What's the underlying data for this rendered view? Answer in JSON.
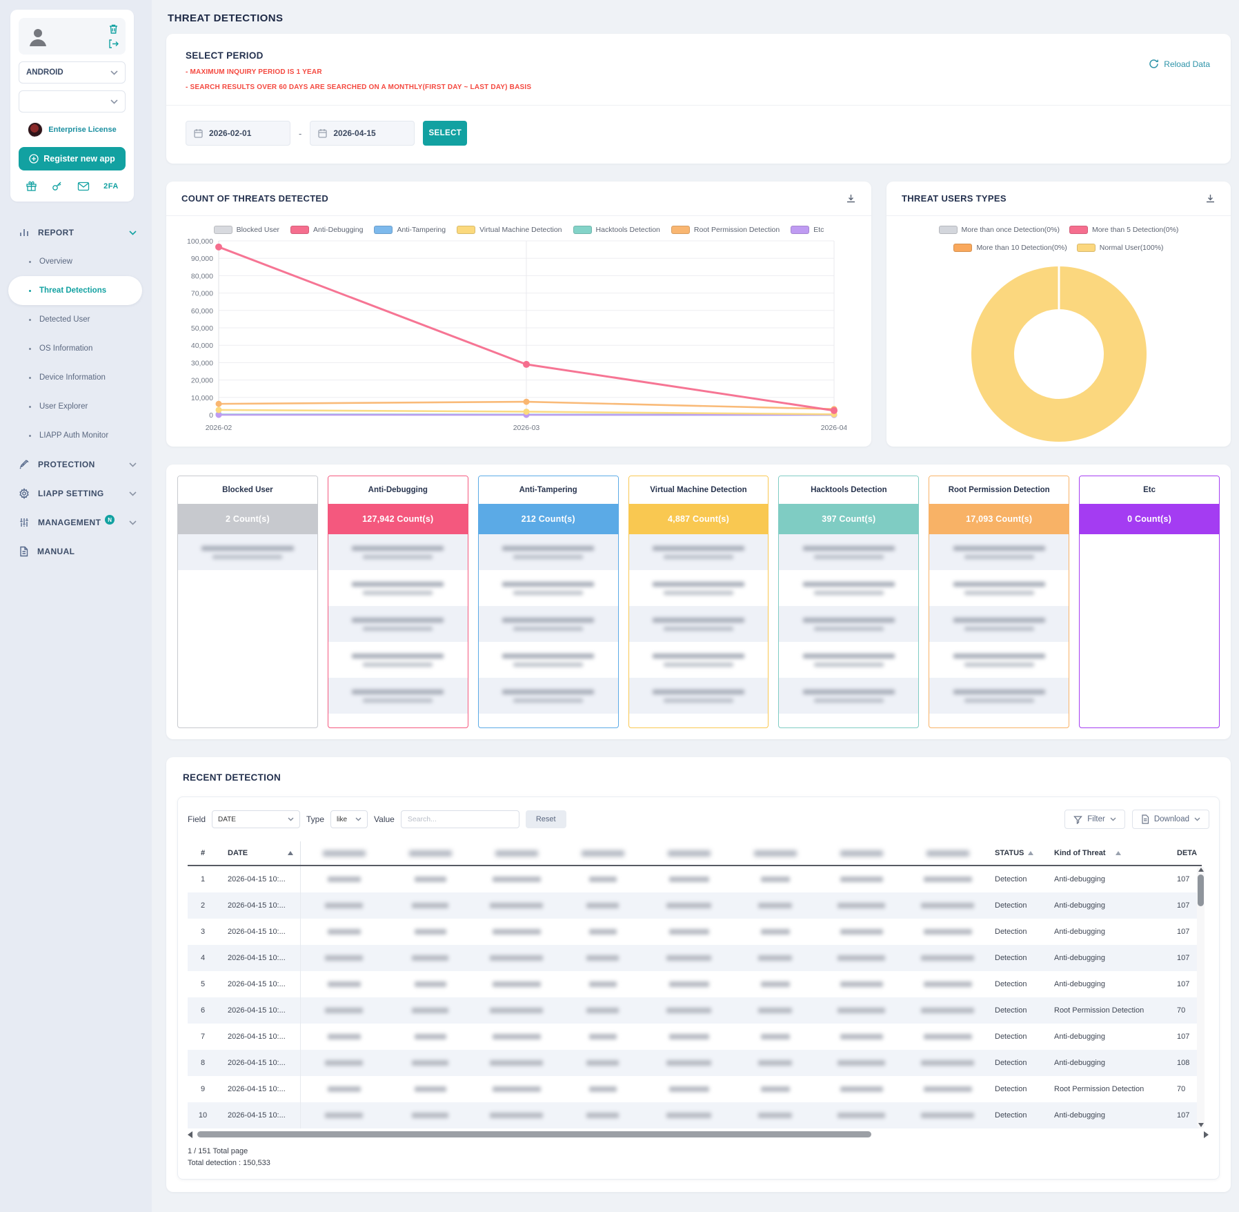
{
  "header": {
    "title": "THREAT DETECTIONS"
  },
  "colors": {
    "accent": "#12a1a1",
    "warning": "#f4483f",
    "normal_user": "#fbd77e"
  },
  "sidebar": {
    "platform_select": {
      "value": "ANDROID"
    },
    "app_select": {
      "value": ""
    },
    "license_label": "Enterprise License",
    "register_button": "Register new app",
    "twofa_label": "2FA",
    "report_menu": {
      "label": "REPORT",
      "active_item": "Threat Detections",
      "items": [
        "Overview",
        "Threat Detections",
        "Detected User",
        "OS Information",
        "Device Information",
        "User Explorer",
        "LIAPP Auth Monitor"
      ]
    },
    "other_menus": [
      {
        "label": "PROTECTION",
        "icon": "syringe-icon",
        "chevron": true
      },
      {
        "label": "LIAPP SETTING",
        "icon": "gear-icon",
        "chevron": true
      },
      {
        "label": "MANAGEMENT",
        "icon": "sliders-icon",
        "badge": "N",
        "chevron": true
      },
      {
        "label": "MANUAL",
        "icon": "document-icon",
        "chevron": false
      }
    ]
  },
  "select_period": {
    "title": "SELECT PERIOD",
    "notes": [
      "- MAXIMUM INQUIRY PERIOD IS 1 YEAR",
      "- SEARCH RESULTS OVER 60 DAYS ARE SEARCHED ON A MONTHLY(FIRST DAY ~ LAST DAY) BASIS"
    ],
    "date_from": "2026-02-01",
    "date_to": "2026-04-15",
    "separator": "-",
    "select_button": "SELECT",
    "reload_label": "Reload Data"
  },
  "chart_data": [
    {
      "type": "line",
      "title": "COUNT OF THREATS DETECTED",
      "x": [
        "2026-02",
        "2026-03",
        "2026-04"
      ],
      "ylim": [
        0,
        100000
      ],
      "ytick_step": 10000,
      "grid": true,
      "legend_position": "top",
      "series": [
        {
          "name": "Blocked User",
          "color": "#d8dadf",
          "values": [
            1,
            1,
            0
          ]
        },
        {
          "name": "Anti-Debugging",
          "color": "#f56e8e",
          "values": [
            96500,
            29000,
            2442
          ]
        },
        {
          "name": "Anti-Tampering",
          "color": "#7db9ec",
          "values": [
            150,
            50,
            12
          ]
        },
        {
          "name": "Virtual Machine Detection",
          "color": "#fbd97d",
          "values": [
            2800,
            1800,
            287
          ]
        },
        {
          "name": "Hacktools Detection",
          "color": "#83d3c8",
          "values": [
            200,
            150,
            47
          ]
        },
        {
          "name": "Root Permission Detection",
          "color": "#f9b671",
          "values": [
            6300,
            7500,
            3293
          ]
        },
        {
          "name": "Etc",
          "color": "#bf9bf2",
          "values": [
            0,
            0,
            0
          ]
        }
      ]
    },
    {
      "type": "donut",
      "title": "THREAT USERS TYPES",
      "slices": [
        {
          "label": "More than once Detection(0%)",
          "value": 0,
          "color": "#d3d6dc"
        },
        {
          "label": "More than 5 Detection(0%)",
          "value": 0,
          "color": "#f56e8e"
        },
        {
          "label": "More than 10 Detection(0%)",
          "value": 0,
          "color": "#f9a85c"
        },
        {
          "label": "Normal User(100%)",
          "value": 100,
          "color": "#fbd77e"
        }
      ]
    }
  ],
  "count_cards": [
    {
      "title": "Blocked User",
      "count": "2 Count(s)",
      "color": "#c7c9ce",
      "blurred_rows": 1
    },
    {
      "title": "Anti-Debugging",
      "count": "127,942 Count(s)",
      "color": "#f4587e",
      "blurred_rows": 5
    },
    {
      "title": "Anti-Tampering",
      "count": "212 Count(s)",
      "color": "#5baae6",
      "blurred_rows": 5
    },
    {
      "title": "Virtual Machine Detection",
      "count": "4,887 Count(s)",
      "color": "#f9c851",
      "blurred_rows": 5
    },
    {
      "title": "Hacktools Detection",
      "count": "397 Count(s)",
      "color": "#7fccc3",
      "blurred_rows": 5
    },
    {
      "title": "Root Permission Detection",
      "count": "17,093 Count(s)",
      "color": "#f8b266",
      "blurred_rows": 5
    },
    {
      "title": "Etc",
      "count": "0 Count(s)",
      "color": "#a43cf2",
      "blurred_rows": 0
    }
  ],
  "recent_detection": {
    "title": "RECENT DETECTION",
    "filter": {
      "field_label": "Field",
      "field_value": "DATE",
      "type_label": "Type",
      "type_value": "like",
      "value_label": "Value",
      "value_placeholder": "Search...",
      "reset_button": "Reset",
      "filter_button": "Filter",
      "download_button": "Download"
    },
    "table": {
      "fixed_headers": [
        "#",
        "DATE"
      ],
      "blurred_header_count": 8,
      "right_headers": [
        "STATUS",
        "Kind of Threat",
        "DETA"
      ],
      "rows": [
        {
          "num": "1",
          "date": "2026-04-15 10:...",
          "status": "Detection",
          "kind": "Anti-debugging",
          "detail": "107"
        },
        {
          "num": "2",
          "date": "2026-04-15 10:...",
          "status": "Detection",
          "kind": "Anti-debugging",
          "detail": "107"
        },
        {
          "num": "3",
          "date": "2026-04-15 10:...",
          "status": "Detection",
          "kind": "Anti-debugging",
          "detail": "107"
        },
        {
          "num": "4",
          "date": "2026-04-15 10:...",
          "status": "Detection",
          "kind": "Anti-debugging",
          "detail": "107"
        },
        {
          "num": "5",
          "date": "2026-04-15 10:...",
          "status": "Detection",
          "kind": "Anti-debugging",
          "detail": "107"
        },
        {
          "num": "6",
          "date": "2026-04-15 10:...",
          "status": "Detection",
          "kind": "Root Permission Detection",
          "detail": "70"
        },
        {
          "num": "7",
          "date": "2026-04-15 10:...",
          "status": "Detection",
          "kind": "Anti-debugging",
          "detail": "107"
        },
        {
          "num": "8",
          "date": "2026-04-15 10:...",
          "status": "Detection",
          "kind": "Anti-debugging",
          "detail": "108"
        },
        {
          "num": "9",
          "date": "2026-04-15 10:...",
          "status": "Detection",
          "kind": "Root Permission Detection",
          "detail": "70"
        },
        {
          "num": "10",
          "date": "2026-04-15 10:...",
          "status": "Detection",
          "kind": "Anti-debugging",
          "detail": "107"
        }
      ]
    },
    "footer": {
      "page_text": "1 / 151 Total page",
      "total_text": "Total detection : 150,533"
    }
  }
}
